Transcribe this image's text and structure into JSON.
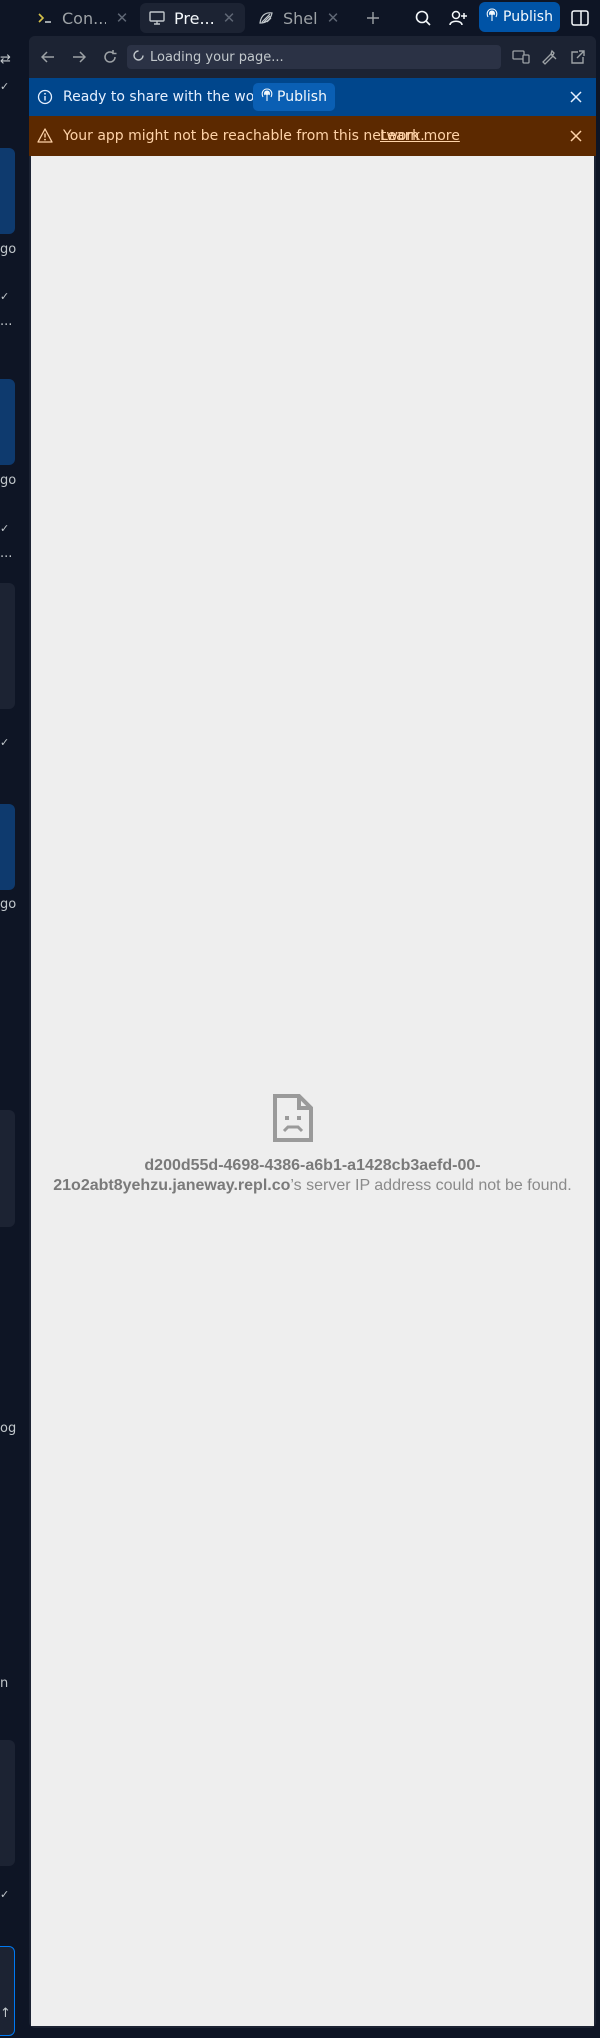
{
  "topbar": {
    "tabs": [
      {
        "label": "Con...",
        "icon": "console-icon",
        "active": false
      },
      {
        "label": "Pre...",
        "icon": "monitor-icon",
        "active": true
      },
      {
        "label": "Shell",
        "icon": "shell-icon",
        "active": false
      }
    ],
    "add_tab_icon": "plus-icon",
    "search_icon": "search-icon",
    "invite_icon": "add-user-icon",
    "publish_label": "Publish",
    "layout_icon": "panel-toggle-icon"
  },
  "sidebar_fragments": {
    "time_ago_1": "go",
    "time_ago_2": "go",
    "time_ago_3": "go",
    "fragment_og": "og",
    "fragment_n": "n",
    "ellipsis": "..."
  },
  "preview": {
    "address_text": "Loading your page...",
    "publish_banner": {
      "text": "Ready to share with the world?",
      "button_label": "Publish",
      "color": "#00468c"
    },
    "network_banner": {
      "text": "Your app might not be reachable from this network.",
      "link_label": "Learn more",
      "color": "#5c2900"
    },
    "error": {
      "host": "d200d55d-4698-4386-a6b1-a1428cb3aefd-00-21o2abt8yehzu.janeway.repl.co",
      "host_line1": "d200d55d-4698-4386-a6b1-a1428cb3aefd-00-",
      "host_line2": "21o2abt8yehzu.janeway.repl.co",
      "message_suffix": "’s server IP address could not be found."
    }
  }
}
